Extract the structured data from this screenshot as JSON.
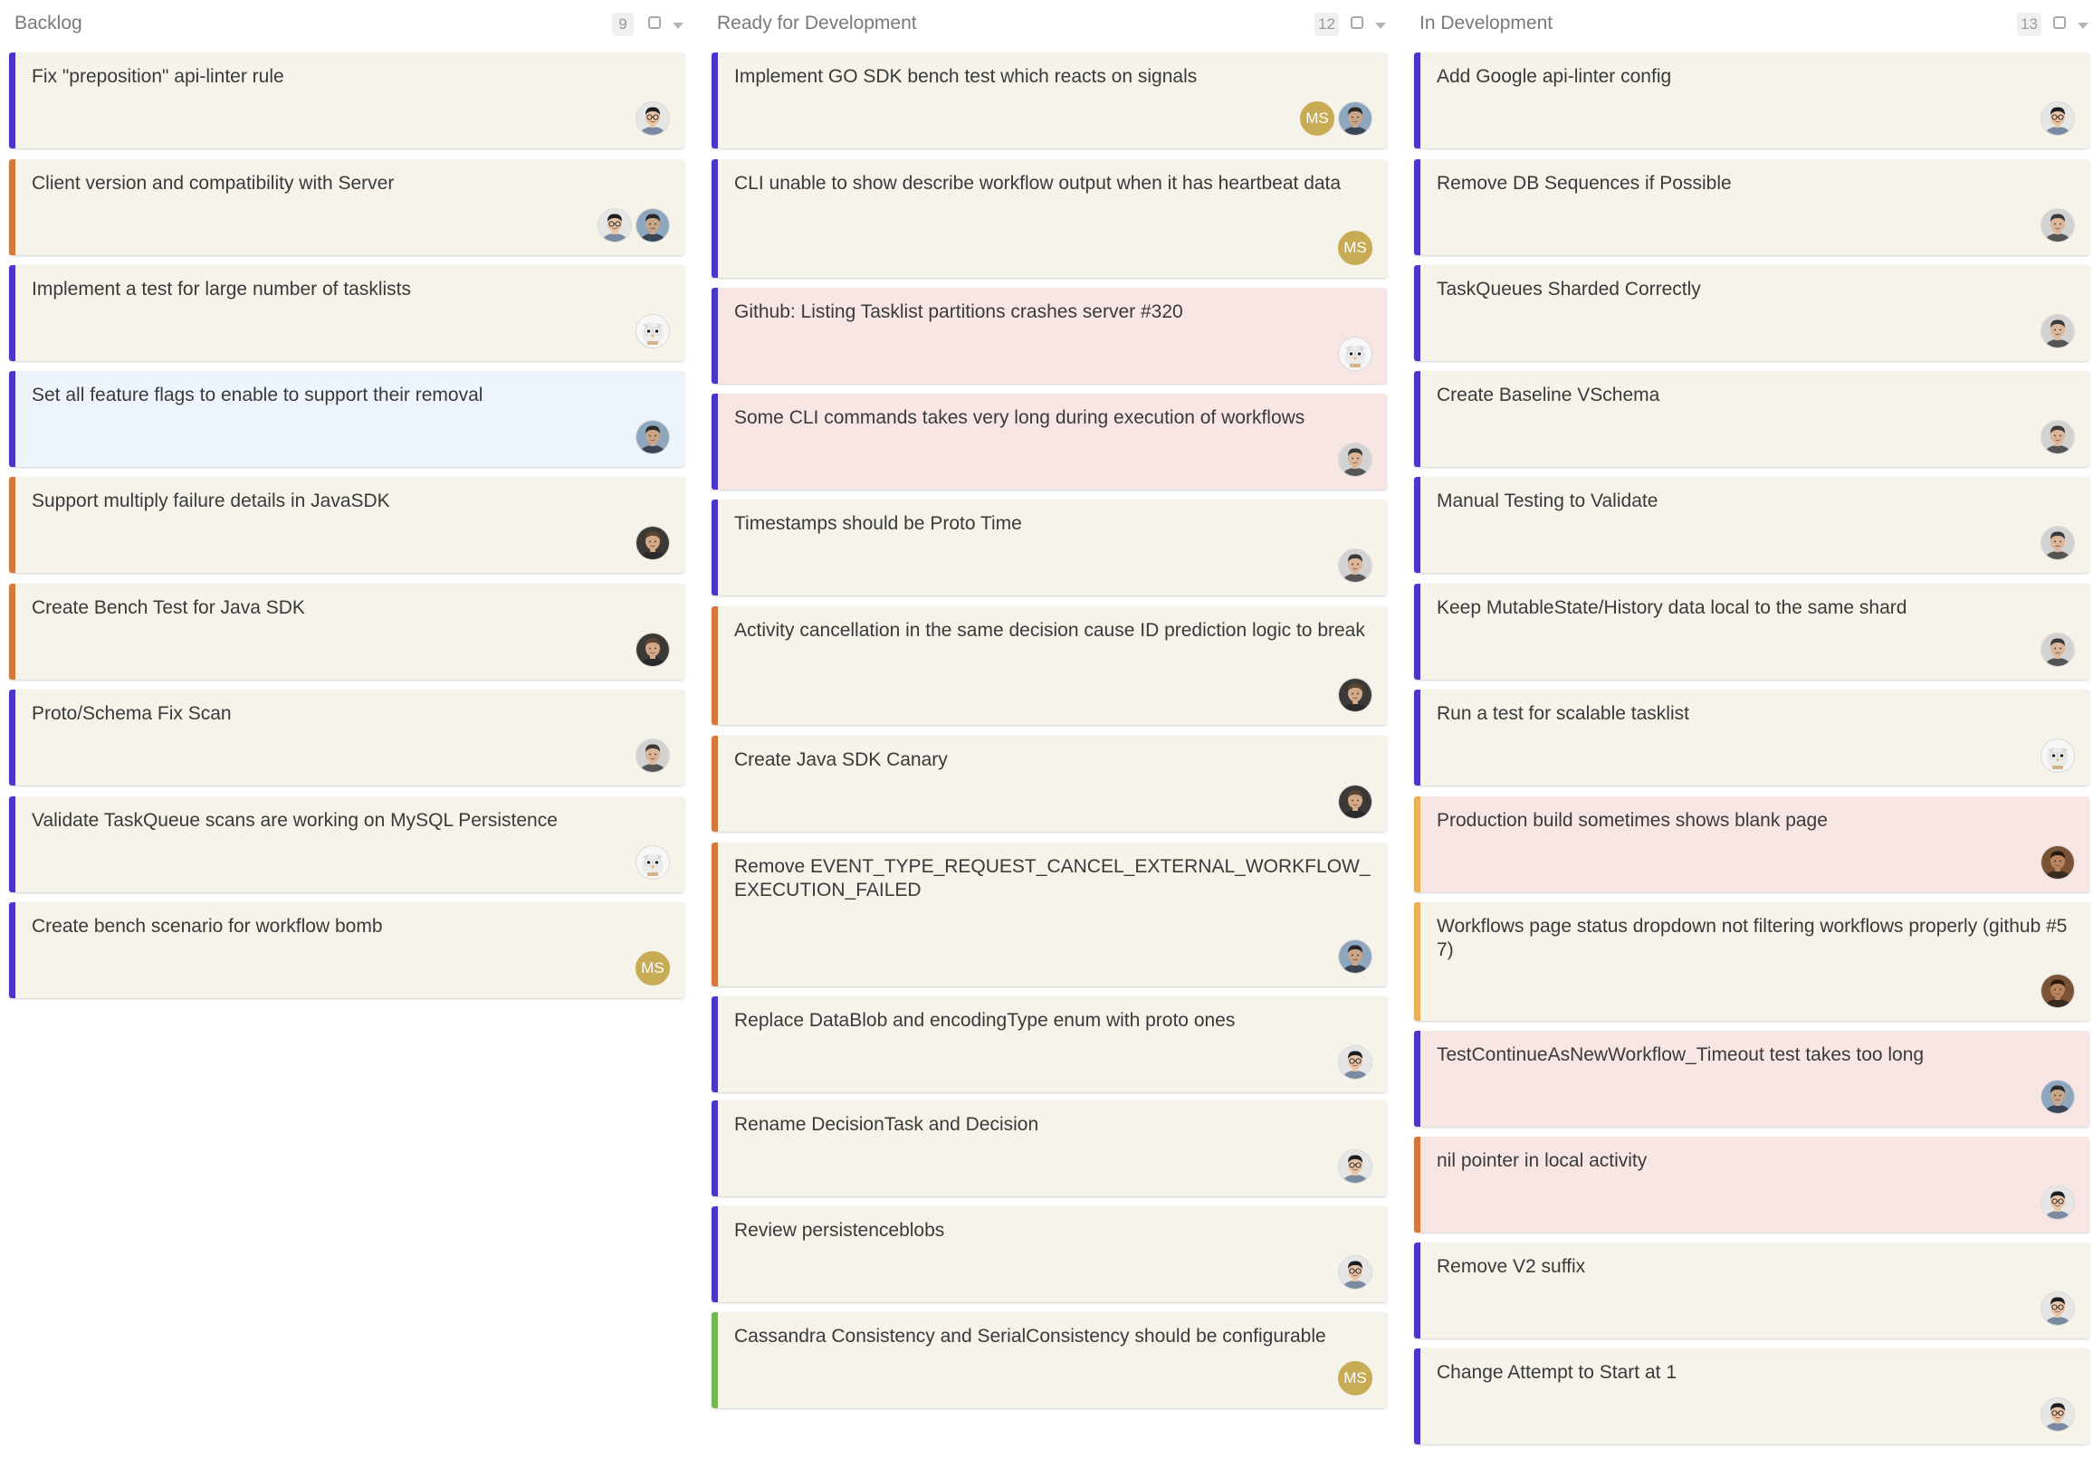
{
  "columns": [
    {
      "title": "Backlog",
      "count": "9",
      "cards": [
        {
          "title": "Fix \"preposition\" api-linter rule",
          "border": "purple",
          "bg": "default",
          "avatars": [
            "person-c"
          ]
        },
        {
          "title": "Client version and compatibility with Server",
          "border": "orange",
          "bg": "default",
          "avatars": [
            "person-c",
            "person-e"
          ]
        },
        {
          "title": "Implement a test for large number of tasklists",
          "border": "purple",
          "bg": "default",
          "avatars": [
            "owl"
          ]
        },
        {
          "title": "Set all feature flags to enable to support their removal",
          "border": "purple",
          "bg": "blue",
          "avatars": [
            "person-e"
          ]
        },
        {
          "title": "Support multiply failure details in JavaSDK",
          "border": "orange",
          "bg": "default",
          "avatars": [
            "person-f"
          ]
        },
        {
          "title": "Create Bench Test for Java SDK",
          "border": "orange",
          "bg": "default",
          "avatars": [
            "person-f"
          ]
        },
        {
          "title": "Proto/Schema Fix Scan",
          "border": "purple",
          "bg": "default",
          "avatars": [
            "person-g"
          ]
        },
        {
          "title": "Validate TaskQueue scans are working on MySQL Persistence",
          "border": "purple",
          "bg": "default",
          "avatars": [
            "owl"
          ]
        },
        {
          "title": "Create bench scenario for workflow bomb",
          "border": "purple",
          "bg": "default",
          "avatars": [
            "MS"
          ]
        }
      ]
    },
    {
      "title": "Ready for Development",
      "count": "12",
      "cards": [
        {
          "title": "Implement GO SDK bench test which reacts on signals",
          "border": "purple",
          "bg": "default",
          "avatars": [
            "MS",
            "person-e"
          ]
        },
        {
          "title": "CLI unable to show describe workflow output when it has heartbeat data",
          "border": "purple",
          "bg": "default",
          "avatars": [
            "MS"
          ]
        },
        {
          "title": "Github: Listing Tasklist partitions crashes server #320",
          "border": "purple",
          "bg": "pink",
          "avatars": [
            "owl"
          ]
        },
        {
          "title": "Some CLI commands takes very long during execution of workflows",
          "border": "purple",
          "bg": "pink",
          "avatars": [
            "person-g"
          ]
        },
        {
          "title": "Timestamps should be Proto Time",
          "border": "purple",
          "bg": "default",
          "avatars": [
            "person-g"
          ]
        },
        {
          "title": "Activity cancellation in the same decision cause ID prediction logic to break",
          "border": "orange",
          "bg": "default",
          "avatars": [
            "person-f"
          ]
        },
        {
          "title": "Create Java SDK Canary",
          "border": "orange",
          "bg": "default",
          "avatars": [
            "person-f"
          ]
        },
        {
          "title": "Remove EVENT_TYPE_REQUEST_CANCEL_EXTERNAL_WORKFLOW_EXECUTION_FAILED",
          "border": "orange",
          "bg": "default",
          "avatars": [
            "person-e"
          ]
        },
        {
          "title": "Replace DataBlob and encodingType enum with proto ones",
          "border": "purple",
          "bg": "default",
          "avatars": [
            "person-c"
          ]
        },
        {
          "title": "Rename DecisionTask and Decision",
          "border": "purple",
          "bg": "default",
          "avatars": [
            "person-c"
          ]
        },
        {
          "title": "Review persistenceblobs",
          "border": "purple",
          "bg": "default",
          "avatars": [
            "person-c"
          ]
        },
        {
          "title": "Cassandra Consistency and SerialConsistency should be configurable",
          "border": "green",
          "bg": "default",
          "avatars": [
            "MS"
          ]
        }
      ]
    },
    {
      "title": "In Development",
      "count": "13",
      "cards": [
        {
          "title": "Add Google api-linter config",
          "border": "purple",
          "bg": "default",
          "avatars": [
            "person-c"
          ]
        },
        {
          "title": "Remove DB Sequences if Possible",
          "border": "purple",
          "bg": "default",
          "avatars": [
            "person-g"
          ]
        },
        {
          "title": "TaskQueues Sharded Correctly",
          "border": "purple",
          "bg": "default",
          "avatars": [
            "person-g"
          ]
        },
        {
          "title": "Create Baseline VSchema",
          "border": "purple",
          "bg": "default",
          "avatars": [
            "person-g"
          ]
        },
        {
          "title": "Manual Testing to Validate",
          "border": "purple",
          "bg": "default",
          "avatars": [
            "person-g"
          ]
        },
        {
          "title": "Keep MutableState/History data local to the same shard",
          "border": "purple",
          "bg": "default",
          "avatars": [
            "person-g"
          ]
        },
        {
          "title": "Run a test for scalable tasklist",
          "border": "purple",
          "bg": "default",
          "avatars": [
            "owl"
          ]
        },
        {
          "title": "Production build sometimes shows blank page",
          "border": "amber",
          "bg": "pink",
          "avatars": [
            "person-h"
          ]
        },
        {
          "title": "Workflows page status dropdown not filtering workflows properly (github #57)",
          "border": "amber",
          "bg": "default",
          "avatars": [
            "person-h"
          ]
        },
        {
          "title": "TestContinueAsNewWorkflow_Timeout test takes too long",
          "border": "purple",
          "bg": "pink",
          "avatars": [
            "person-e"
          ]
        },
        {
          "title": "nil pointer in local activity",
          "border": "orange",
          "bg": "pink",
          "avatars": [
            "person-c"
          ]
        },
        {
          "title": "Remove V2 suffix",
          "border": "purple",
          "bg": "default",
          "avatars": [
            "person-c"
          ]
        },
        {
          "title": "Change Attempt to Start at 1",
          "border": "purple",
          "bg": "default",
          "avatars": [
            "person-c"
          ]
        }
      ]
    }
  ]
}
